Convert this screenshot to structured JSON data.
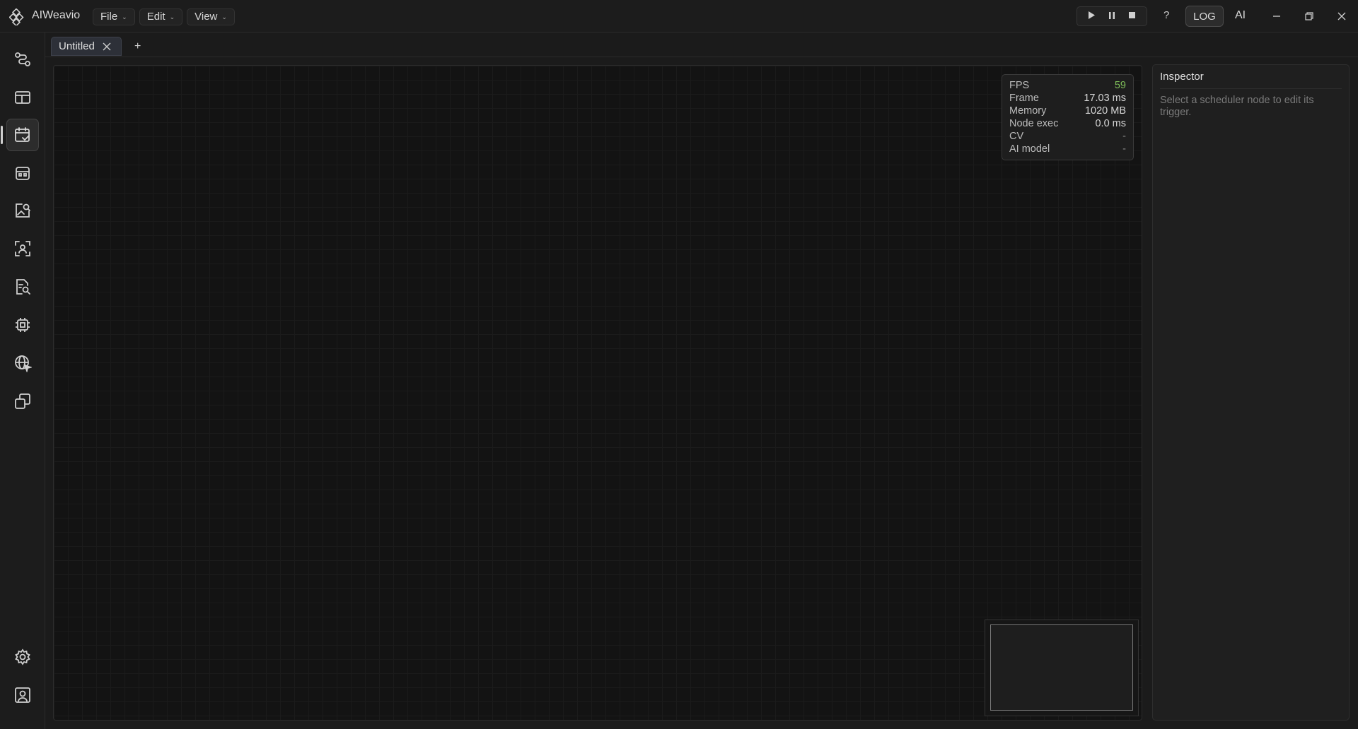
{
  "app": {
    "name": "AIWeavio"
  },
  "menu": [
    {
      "label": "File"
    },
    {
      "label": "Edit"
    },
    {
      "label": "View"
    }
  ],
  "toolbar": {
    "play_icon": "play-icon",
    "pause_icon": "pause-icon",
    "stop_icon": "stop-icon",
    "help_label": "?",
    "log_label": "LOG",
    "ai_label": "AI"
  },
  "window_controls": [
    "minimize-icon",
    "restore-icon",
    "close-icon"
  ],
  "sidebar": {
    "items": [
      {
        "icon": "workflow-icon"
      },
      {
        "icon": "dashboard-icon"
      },
      {
        "icon": "calendar-check-icon",
        "active": true
      },
      {
        "icon": "robot-icon"
      },
      {
        "icon": "image-search-icon"
      },
      {
        "icon": "face-scan-icon"
      },
      {
        "icon": "document-search-icon"
      },
      {
        "icon": "chip-icon"
      },
      {
        "icon": "globe-cursor-icon"
      },
      {
        "icon": "layers-icon"
      }
    ],
    "bottom": [
      {
        "icon": "gear-icon"
      },
      {
        "icon": "user-card-icon"
      }
    ]
  },
  "tabs": [
    {
      "label": "Untitled"
    }
  ],
  "add_tab_label": "+",
  "stats": [
    {
      "key": "FPS",
      "value": "59",
      "tone": "green"
    },
    {
      "key": "Frame",
      "value": "17.03 ms"
    },
    {
      "key": "Memory",
      "value": "1020 MB"
    },
    {
      "key": "Node exec",
      "value": "0.0 ms"
    },
    {
      "key": "CV",
      "value": "-",
      "tone": "dim"
    },
    {
      "key": "AI model",
      "value": "-",
      "tone": "dim"
    }
  ],
  "inspector": {
    "title": "Inspector",
    "hint": "Select a scheduler node to edit its trigger."
  },
  "colors": {
    "background": "#1b1b1b",
    "canvas": "#131313",
    "fps_green": "#7fbf5a",
    "tab_active": "#2d3038"
  }
}
